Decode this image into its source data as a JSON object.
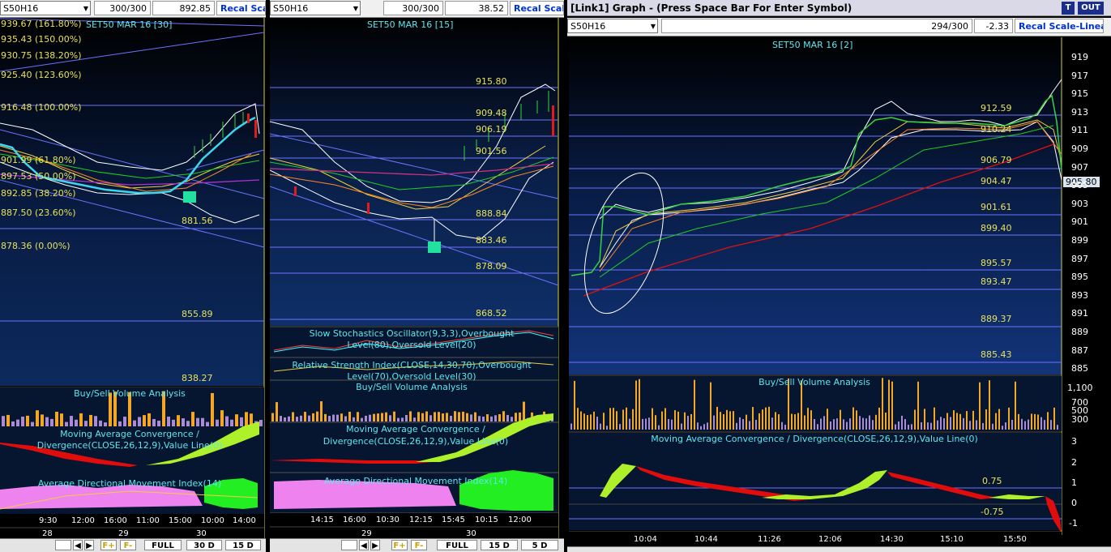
{
  "panel1": {
    "symbol": "S50H16",
    "bars": "300/300",
    "last": "892.85",
    "recal": "Recal Scale",
    "title": "SET50 MAR 16  [30]",
    "fib_levels": [
      "939.67 (161.80%)",
      "935.43 (150.00%)",
      "930.75 (138.20%)",
      "925.40 (123.60%)",
      "916.48 (100.00%)",
      "901.99 (61.80%)",
      "897.53 (50.00%)",
      "892.85 (38.20%)",
      "887.50 (23.60%)",
      "878.36 (0.00%)"
    ],
    "levels": [
      "881.56",
      "855.89",
      "838.27"
    ],
    "ind_volume": "Buy/Sell Volume Analysis",
    "ind_macd": "Moving Average Convergence / Divergence(CLOSE,26,12,9),Value Line(0)",
    "ind_adx": "Average Directional Movement Index(14)",
    "times": [
      "9:30",
      "12:00",
      "16:00",
      "11:00",
      "15:00",
      "10:00",
      "14:00"
    ],
    "days": [
      "28",
      "29",
      "30"
    ],
    "buttons": [
      "FULL",
      "30 D",
      "15 D"
    ]
  },
  "panel2": {
    "symbol": "S50H16",
    "bars": "300/300",
    "last": "38.52",
    "recal": "Recal Scale",
    "title": "SET50 MAR 16  [15]",
    "levels": [
      "915.80",
      "909.48",
      "906.19",
      "901.56",
      "888.84",
      "883.46",
      "878.09",
      "868.52"
    ],
    "ind_stoch": "Slow Stochastics Oscillator(9,3,3),Overbought Level(80),Oversold Level(20)",
    "ind_rsi": "Relative Strength Index(CLOSE,14,30,70),Overbought Level(70),Oversold Level(30)",
    "ind_volume": "Buy/Sell Volume Analysis",
    "ind_macd": "Moving Average Convergence / Divergence(CLOSE,26,12,9),Value Line(0)",
    "ind_adx": "Average Directional Movement Index(14)",
    "times": [
      "14:15",
      "16:00",
      "10:30",
      "12:15",
      "15:45",
      "10:15",
      "12:00"
    ],
    "days": [
      "29",
      "30"
    ],
    "buttons": [
      "FULL",
      "15 D",
      "5 D"
    ]
  },
  "panel3": {
    "window_title": "[Link1] Graph  - (Press Space Bar For Enter Symbol)",
    "btn_t": "T",
    "btn_out": "OUT",
    "symbol": "S50H16",
    "bars": "294/300",
    "last": "-2.33",
    "recal": "Recal Scale-Linear",
    "title": "SET50 MAR 16  [2]",
    "levels": [
      "912.59",
      "910.24",
      "906.79",
      "904.47",
      "901.61",
      "899.40",
      "895.57",
      "893.47",
      "889.37",
      "885.43"
    ],
    "price_tag": "905.80",
    "y_ticks": [
      "919",
      "917",
      "915",
      "913",
      "911",
      "909",
      "907",
      "905",
      "903",
      "901",
      "899",
      "897",
      "895",
      "893",
      "891",
      "889",
      "887",
      "885"
    ],
    "ind_volume": "Buy/Sell Volume Analysis",
    "vol_ticks": [
      "1,100",
      "700",
      "500",
      "300"
    ],
    "ind_macd": "Moving Average Convergence / Divergence(CLOSE,26,12,9),Value Line(0)",
    "macd_ticks": [
      "3",
      "2",
      "1",
      "0",
      "-1"
    ],
    "macd_levels": [
      "0.75",
      "-0.75"
    ],
    "times": [
      "10:04",
      "10:44",
      "11:26",
      "12:06",
      "14:30",
      "15:10",
      "15:50"
    ]
  },
  "colors": {
    "bg_top": "#071a3d",
    "bg_bottom": "#000000",
    "level_line": "#7a82ff",
    "level_text": "#e8e25a",
    "title_text": "#5ee8ee",
    "candle_up": "#39d23c",
    "candle_down": "#e11a1a",
    "volume_buy": "#f5a623",
    "volume_sell": "#a98bd6",
    "macd_pos": "#aef02a",
    "macd_neg": "#e10d0d",
    "adx_fill": "#ee82ee",
    "adx_green": "#22ee22"
  }
}
